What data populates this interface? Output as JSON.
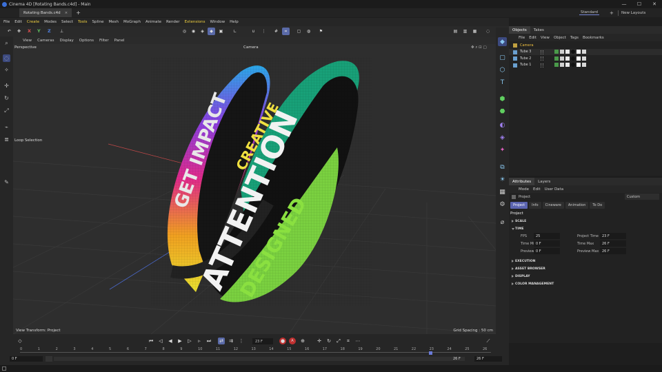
{
  "window": {
    "title": "Cinema 4D [Rotating Bands.c4d] - Main",
    "min": "—",
    "max": "☐",
    "close": "✕"
  },
  "tabs": {
    "doc_tab": "Rotating Bands.c4d",
    "close": "×",
    "add": "+",
    "layout": "Standard",
    "new_layouts": "New Layouts"
  },
  "menu": [
    "File",
    "Edit",
    "Create",
    "Modes",
    "Select",
    "Tools",
    "Spline",
    "Mesh",
    "MoGraph",
    "Animate",
    "Render",
    "Extensions",
    "Window",
    "Help"
  ],
  "menu_highlight": [
    "Create",
    "Tools",
    "Extensions"
  ],
  "axes": {
    "x": "X",
    "y": "Y",
    "z": "Z"
  },
  "viewport": {
    "menu": [
      "View",
      "Cameras",
      "Display",
      "Options",
      "Filter",
      "Panel"
    ],
    "label": "Perspective",
    "camera": "Camera",
    "tool_label": "Loop Selection",
    "view_transform": "View Transform: Project",
    "grid_spacing": "Grid Spacing : 50 cm",
    "band_texts": [
      "GET IMPACT",
      "CREATIVE",
      "ATTENTION",
      "DESIGNED"
    ]
  },
  "objects_panel": {
    "tabs": [
      "Objects",
      "Takes"
    ],
    "menu": [
      "File",
      "Edit",
      "View",
      "Object",
      "Tags",
      "Bookmarks"
    ],
    "items": [
      {
        "name": "Camera",
        "color": "#f0c040"
      },
      {
        "name": "Tube 3",
        "color": "#d8d8d8"
      },
      {
        "name": "Tube 2",
        "color": "#d8d8d8"
      },
      {
        "name": "Tube 1",
        "color": "#d8d8d8"
      }
    ]
  },
  "attributes_panel": {
    "tabs": [
      "Attributes",
      "Layers"
    ],
    "menu": [
      "Mode",
      "Edit",
      "User Data"
    ],
    "object": "Project",
    "preset": "Custom",
    "subtabs": [
      "Project",
      "Info",
      "Cineware",
      "Animation",
      "To Do"
    ],
    "heading": "Project",
    "sections": {
      "scale": "SCALE",
      "time": "TIME",
      "execution": "EXECUTION",
      "asset_browser": "ASSET BROWSER",
      "display": "DISPLAY",
      "color_management": "COLOR MANAGEMENT"
    },
    "fields": {
      "fps": {
        "label": "FPS",
        "value": "25"
      },
      "project_time": {
        "label": "Project Time",
        "value": "23 F"
      },
      "time_min": {
        "label": "Time Min",
        "value": "0 F"
      },
      "time_max": {
        "label": "Time Max",
        "value": "26 F"
      },
      "preview_min": {
        "label": "Preview Min",
        "value": "0 F"
      },
      "preview_max": {
        "label": "Preview Max",
        "value": "26 F"
      }
    }
  },
  "timeline": {
    "current_frame": "23 F",
    "ticks": [
      "0",
      "1",
      "2",
      "3",
      "4",
      "5",
      "6",
      "7",
      "8",
      "9",
      "10",
      "11",
      "12",
      "13",
      "14",
      "15",
      "16",
      "17",
      "18",
      "19",
      "20",
      "21",
      "22",
      "23",
      "24",
      "25",
      "26"
    ],
    "start": "0 F",
    "preview_start": "0 F",
    "preview_end": "26 F",
    "end": "26 F"
  },
  "colors": {
    "accent": "#5a6aa8",
    "record": "#d03030",
    "highlight": "#f0d040"
  }
}
